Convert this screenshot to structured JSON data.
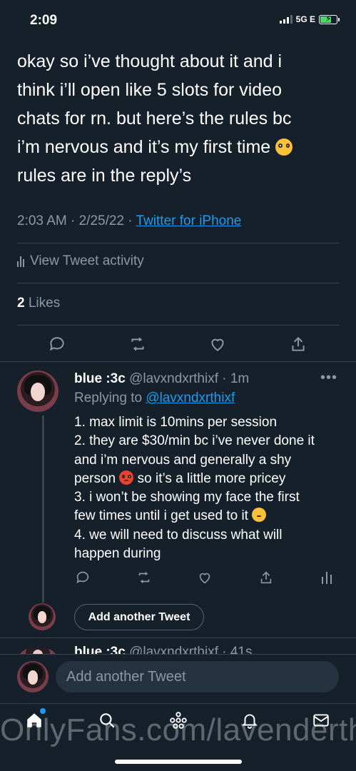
{
  "status_bar": {
    "time": "2:09",
    "network": "5G E"
  },
  "tweet": {
    "text_lines": [
      "okay so i’ve thought about it and i",
      "think i’ll open like 5 slots for video",
      "chats for rn. but here’s the rules bc",
      "i’m nervous and it’s my first time",
      "rules are in the reply’s"
    ],
    "time": "2:03 AM · 2/25/22 · ",
    "source": "Twitter for iPhone",
    "activity_label": "View Tweet activity",
    "likes_count": "2",
    "likes_label": "Likes"
  },
  "reply": {
    "name": "blue :3c",
    "handle": "@lavxndxrthixf",
    "time": " · 1m",
    "replying_prefix": "Replying to ",
    "replying_handle": "@lavxndxrthixf",
    "lines": {
      "l1": "1. max limit is 10mins per session",
      "l2": "2. they are $30/min bc i’ve never done it",
      "l3": "and i’m nervous and generally a shy",
      "l4a": "person",
      "l4b": " so it’s a little more pricey",
      "l5": "3. i won’t be showing my face the first",
      "l6": "few times until i get used to it",
      "l7": "4. we will need to discuss what will",
      "l8": "happen during"
    },
    "more_label": "•••"
  },
  "add_another_button": "Add another Tweet",
  "next_reply_peek": {
    "name": "blue :3c",
    "rest": " @lavxndxrthixf · 41s"
  },
  "compose": {
    "placeholder": "Add another Tweet"
  },
  "watermark": "OnlyFans.com/lavenderthief",
  "colors": {
    "background": "#15202b",
    "accent": "#1d9bf0",
    "muted": "#8b98a5",
    "divider": "#38444d"
  },
  "icons": {
    "actions": [
      "reply-icon",
      "retweet-icon",
      "like-icon",
      "share-icon",
      "analytics-icon"
    ],
    "tabs": [
      "home-icon",
      "search-icon",
      "spaces-icon",
      "notifications-icon",
      "messages-icon"
    ]
  }
}
